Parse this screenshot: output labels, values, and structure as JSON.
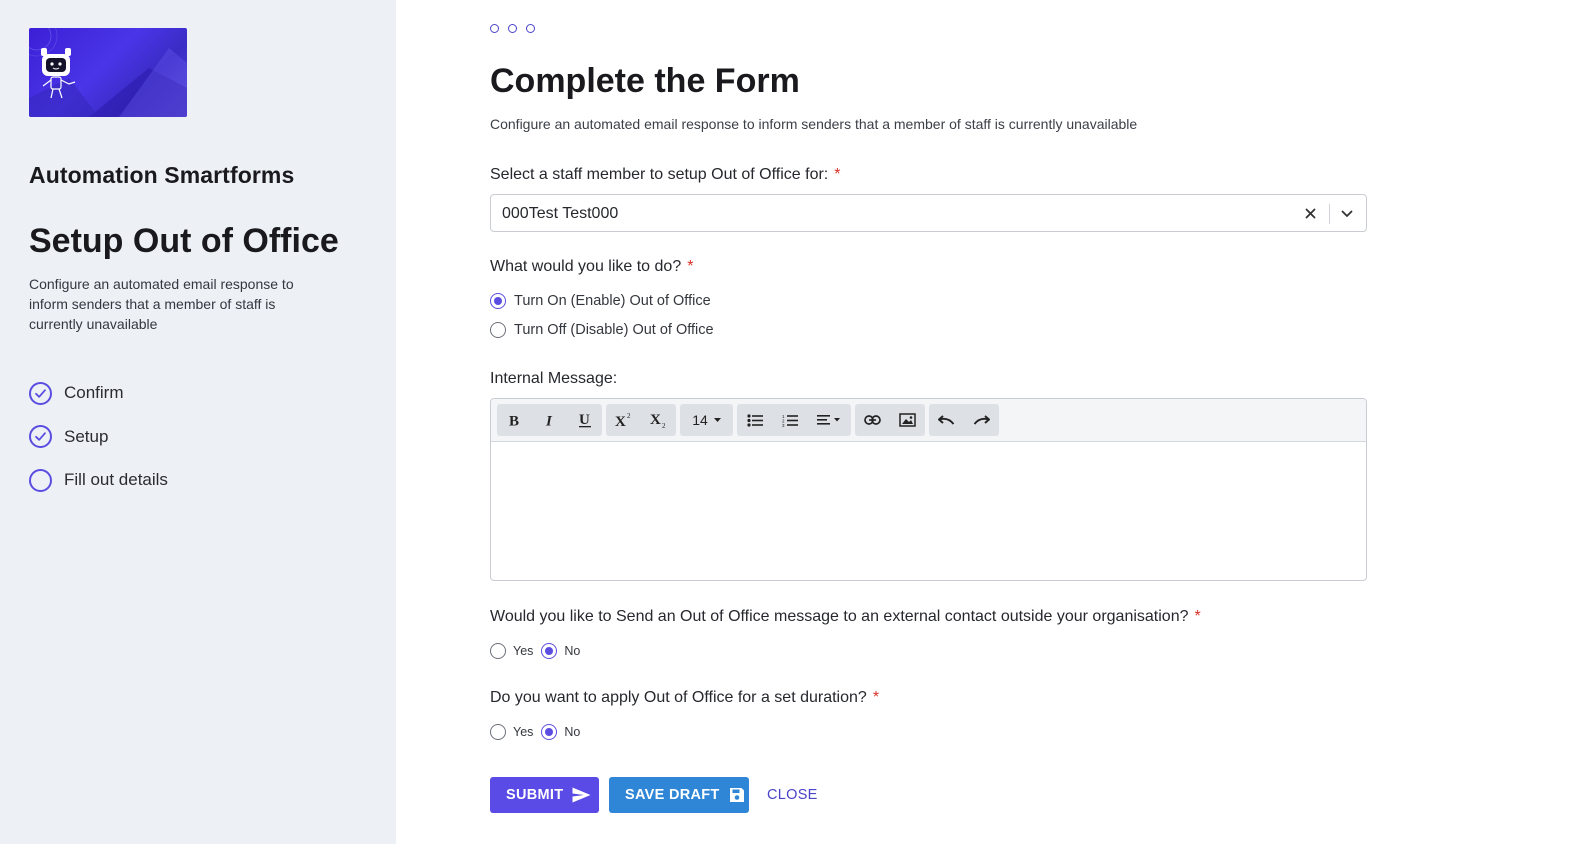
{
  "sidebar": {
    "app_title": "Automation Smartforms",
    "page_title": "Setup Out of Office",
    "description": "Configure an automated email response to inform senders that a member of staff is currently unavailable",
    "steps": [
      {
        "label": "Confirm",
        "state": "complete"
      },
      {
        "label": "Setup",
        "state": "complete"
      },
      {
        "label": "Fill out details",
        "state": "current"
      }
    ]
  },
  "form": {
    "title": "Complete the Form",
    "description": "Configure an automated email response to inform senders that a member of staff is currently unavailable",
    "staff": {
      "label": "Select a staff member to setup Out of Office for:",
      "required_mark": "*",
      "value": "000Test Test000"
    },
    "action": {
      "label": "What would you like to do?",
      "required_mark": "*",
      "options": [
        "Turn On (Enable) Out of Office",
        "Turn Off (Disable) Out of Office"
      ],
      "selected": "Turn On (Enable) Out of Office"
    },
    "internal_message": {
      "label": "Internal Message:",
      "font_size": "14",
      "value": ""
    },
    "external": {
      "label": "Would you like to Send an Out of Office message to an external contact outside your organisation?",
      "required_mark": "*",
      "options": [
        "Yes",
        "No"
      ],
      "selected": "No"
    },
    "duration": {
      "label": "Do you want to apply Out of Office for a set duration?",
      "required_mark": "*",
      "options": [
        "Yes",
        "No"
      ],
      "selected": "No"
    },
    "buttons": {
      "submit": "SUBMIT",
      "save_draft": "SAVE DRAFT",
      "close": "CLOSE"
    }
  },
  "colors": {
    "accent": "#5b4de0",
    "submit": "#5a4ae6",
    "save_draft": "#2f86d6",
    "required": "#d93025",
    "sidebar_bg": "#edf1f6"
  },
  "icons": {
    "logo": "robot-logo",
    "step_complete": "check-circle-icon",
    "step_current": "empty-circle-icon",
    "submit": "send-icon",
    "save_draft": "floppy-disk-icon"
  }
}
